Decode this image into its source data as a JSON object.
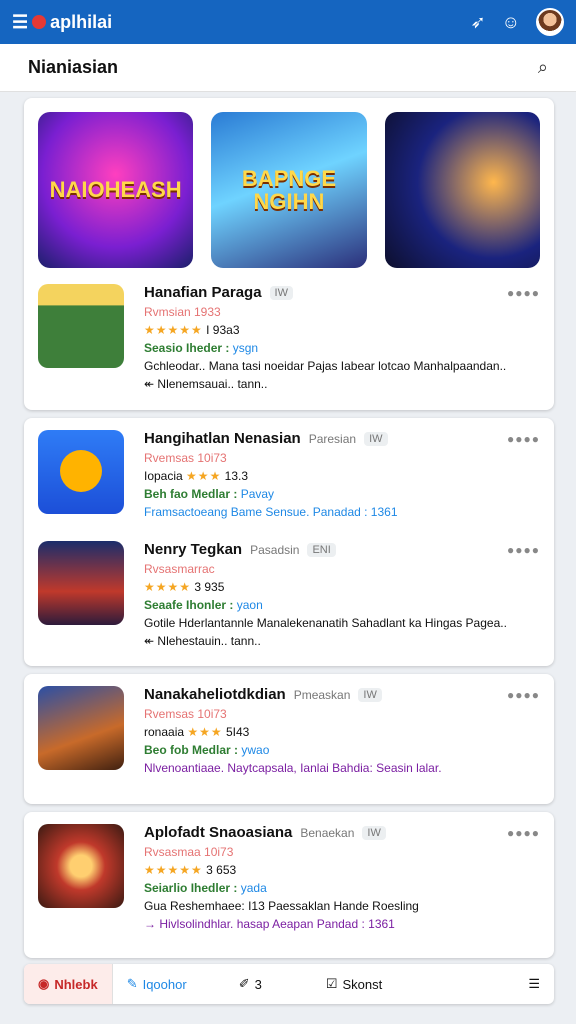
{
  "topbar": {
    "brand": "aplhilai",
    "menu_icon": "menu-icon",
    "icons": [
      "navigation-icon",
      "smile-icon"
    ]
  },
  "header": {
    "title": "Nianiasian",
    "search_icon": "search-icon"
  },
  "featured": [
    {
      "title": "NAIOHEASH"
    },
    {
      "title": "BAPNGE NGIHN"
    },
    {
      "title": ""
    }
  ],
  "apps": [
    {
      "name": "Hanafian Paraga",
      "tag": "IW",
      "sub": "Rvmsian 1933",
      "rating_text": "⁎⁎",
      "rating": 4.5,
      "rating_label": "I 93a3",
      "green": "Seasio Iheder :",
      "blue": "ysgn",
      "desc": "Gchleodar.. Mana tasi noeidar Pajas Iabear lotcao Manhalpaandan..",
      "extra": "Nlenemsauai.. tann.."
    },
    {
      "name": "Hangihatlan Nenasian",
      "meta": "Paresian",
      "tag": "IW",
      "sub": "Rvemsas 10i73",
      "rating_text": "Iopacia",
      "rating": 3,
      "rating_label": "13.3",
      "green": "Beh fao Medlar :",
      "blue": "Pavay",
      "desc": "Framsactoeang Bame Sensue. Panadad : 1361"
    },
    {
      "name": "Nenry Tegkan",
      "meta": "Pasadsin",
      "tag": "ENI",
      "sub": "Rvsasmarrac",
      "rating_text": "⁎⁎",
      "rating": 4,
      "rating_label": "3 935",
      "green": "Seaafe Ihonler :",
      "blue": "yaon",
      "desc": "Gotile Hderlantannle Manalekenanatih Sahadlant ka Hingas Pagea..",
      "extra": "Nlehestauin.. tann.."
    },
    {
      "name": "Nanakaheliotdkdian",
      "meta": "Pmeaskan",
      "tag": "IW",
      "sub": "Rvemsas 10i73",
      "rating_text": "ronaaia",
      "rating": 3,
      "rating_label": "5I43",
      "green": "Beo fob Medlar :",
      "blue": "ywao",
      "desc": "Nlvenoantiaae. Naytcapsala, Ianlai Bahdia: Seasin lalar."
    },
    {
      "name": "Aplofadt Snaoasiana",
      "meta": "Benaekan",
      "tag": "IW",
      "sub": "Rvsasmaa 10i73",
      "rating_text": "⁎⁎",
      "rating": 4.5,
      "rating_label": "3 653",
      "green": "Seiarlio Ihedler :",
      "blue": "yada",
      "desc": "Gua Reshemhaee: I13 Paessaklan Hande Roesling",
      "extra": "Hivlsolindhlar. hasap Aeapan Pandad : 1361"
    }
  ],
  "bottomnav": [
    {
      "label": "Nhlebk",
      "icon": "record-icon"
    },
    {
      "label": "Iqoohor",
      "icon": "edit-icon"
    },
    {
      "label": "3",
      "icon": "pencil-icon"
    },
    {
      "label": "Skonst",
      "icon": "checkbox-icon"
    },
    {
      "label": "",
      "icon": "list-icon"
    }
  ]
}
